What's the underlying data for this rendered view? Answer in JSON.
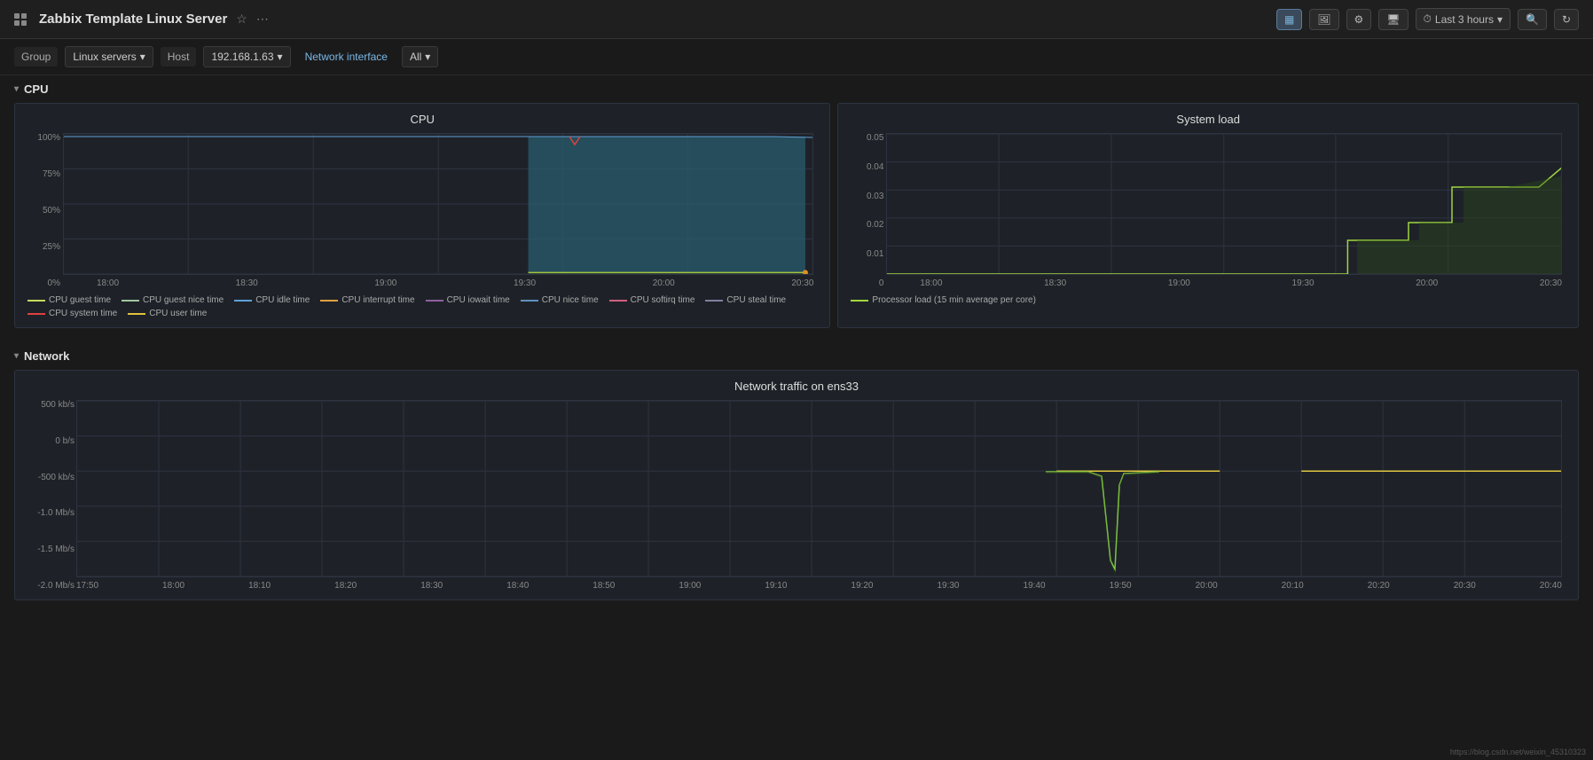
{
  "header": {
    "title": "Zabbix Template Linux Server",
    "star_icon": "★",
    "share_icon": "⋯",
    "toolbar_icons": [
      "bar-chart-icon",
      "image-icon",
      "gear-icon",
      "monitor-icon"
    ],
    "time_range": "Last 3 hours",
    "zoom_out_icon": "zoom-out-icon",
    "refresh_icon": "refresh-icon"
  },
  "filters": {
    "group_label": "Group",
    "group_value": "Linux servers",
    "host_label": "Host",
    "host_value": "192.168.1.63",
    "network_interface_label": "Network interface",
    "all_label": "All"
  },
  "cpu_section": {
    "label": "CPU",
    "cpu_chart": {
      "title": "CPU",
      "y_labels": [
        "100%",
        "75%",
        "50%",
        "25%",
        "0%"
      ],
      "x_labels": [
        "18:00",
        "18:30",
        "19:00",
        "19:30",
        "20:00",
        "20:30"
      ],
      "legend": [
        {
          "color": "#c8d860",
          "label": "CPU guest time"
        },
        {
          "color": "#a0c8a0",
          "label": "CPU guest nice time"
        },
        {
          "color": "#60a0d8",
          "label": "CPU idle time"
        },
        {
          "color": "#e0a040",
          "label": "CPU interrupt time"
        },
        {
          "color": "#9060a0",
          "label": "CPU iowait time"
        },
        {
          "color": "#6090c0",
          "label": "CPU nice time"
        },
        {
          "color": "#d06080",
          "label": "CPU softirq time"
        },
        {
          "color": "#8080a0",
          "label": "CPU steal time"
        },
        {
          "color": "#e04040",
          "label": "CPU system time"
        },
        {
          "color": "#e0c040",
          "label": "CPU user time"
        }
      ]
    },
    "system_load_chart": {
      "title": "System load",
      "y_labels": [
        "0.05",
        "0.04",
        "0.03",
        "0.02",
        "0.01",
        "0"
      ],
      "x_labels": [
        "18:00",
        "18:30",
        "19:00",
        "19:30",
        "20:00",
        "20:30"
      ],
      "legend": [
        {
          "color": "#a0d840",
          "label": "Processor load (15 min average per core)"
        }
      ]
    }
  },
  "network_section": {
    "label": "Network",
    "network_chart": {
      "title": "Network traffic on ens33",
      "y_labels": [
        "500 kb/s",
        "0 b/s",
        "-500 kb/s",
        "-1.0 Mb/s",
        "-1.5 Mb/s",
        "-2.0 Mb/s"
      ],
      "x_labels": [
        "17:50",
        "18:00",
        "18:10",
        "18:20",
        "18:30",
        "18:40",
        "18:50",
        "19:00",
        "19:10",
        "19:20",
        "19:30",
        "19:40",
        "19:50",
        "20:00",
        "20:10",
        "20:20",
        "20:30",
        "20:40"
      ]
    }
  }
}
